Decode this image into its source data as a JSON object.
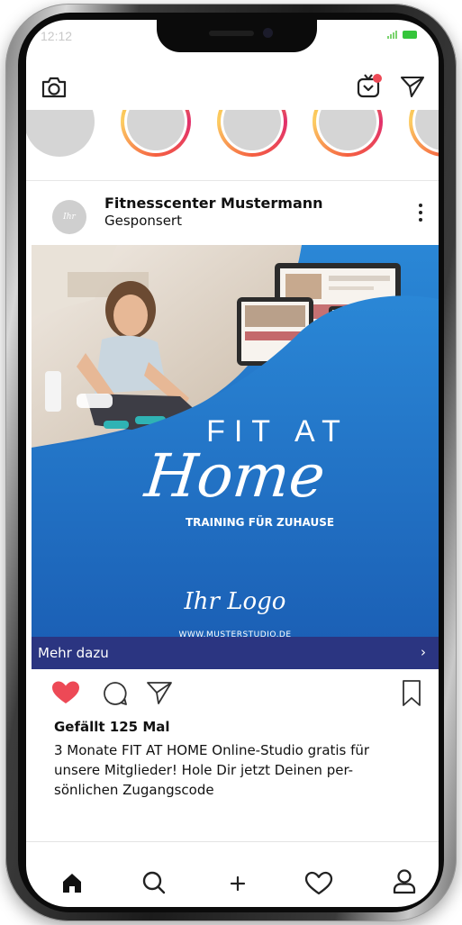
{
  "status_bar": {
    "time": "12:12"
  },
  "top_bar": {
    "left_icon": "camera-icon",
    "right_icons": [
      "igtv-icon",
      "direct-message-icon"
    ]
  },
  "stories": {
    "count": 5
  },
  "post": {
    "account_name": "Fitnesscenter Mustermann",
    "sponsored_label": "Gesponsert",
    "avatar_text": "Ihr Logo",
    "ad": {
      "headline_top": "FIT AT",
      "headline_script": "Home",
      "subheadline": "TRAINING FÜR ZUHAUSE",
      "logo_text": "Ihr Logo",
      "website": "WWW.MUSTERSTUDIO.DE"
    },
    "cta_label": "Mehr dazu",
    "cta_arrow": "›",
    "liked": true,
    "likes_text": "Gefällt 125 Mal",
    "caption_lines": [
      "3 Monate FIT AT HOME Online-Studio gratis für",
      "unsere Mitglieder! Hole Dir jetzt Deinen per-",
      "sönlichen Zugangscode"
    ]
  },
  "bottom_nav": {
    "items": [
      "home-icon",
      "search-icon",
      "add-icon",
      "activity-heart-icon",
      "profile-icon"
    ]
  },
  "colors": {
    "like_red": "#ed4956",
    "cta_bg": "#2b3581",
    "ad_blue": "#1d6fc3",
    "story_ring": "#e1306c"
  }
}
